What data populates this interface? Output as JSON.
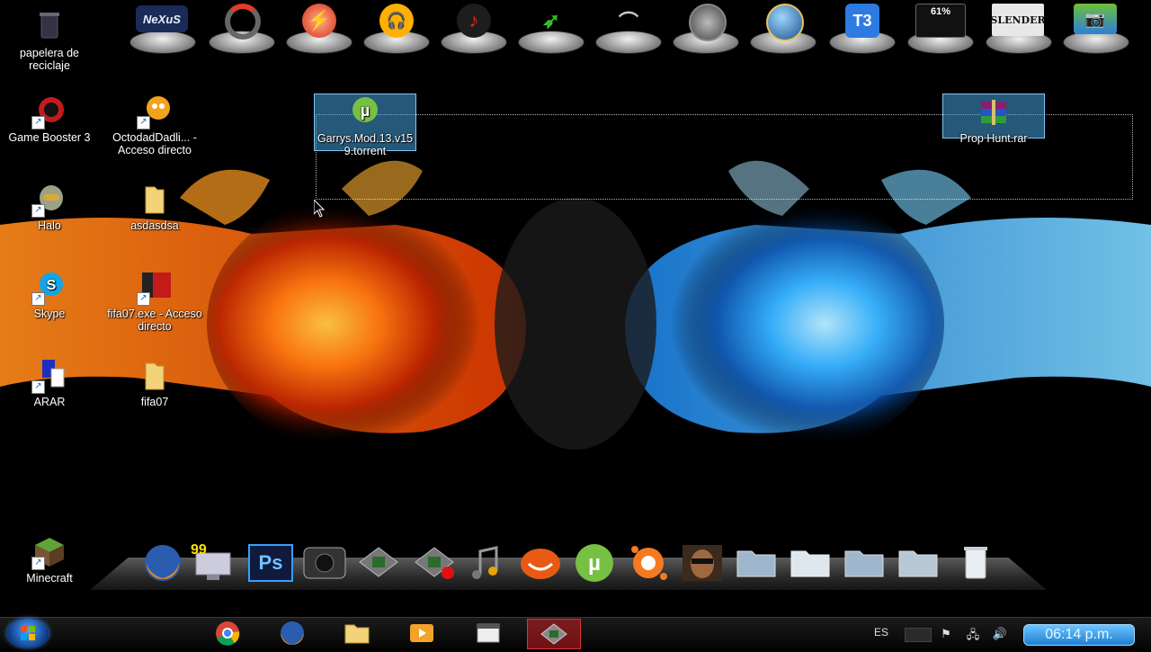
{
  "desktop": {
    "icons": [
      {
        "label": "papelera de reciclaje"
      },
      {
        "label": "Game Booster 3"
      },
      {
        "label": "OctodadDadli... - Acceso directo"
      },
      {
        "label": "Halo"
      },
      {
        "label": "asdasdsa"
      },
      {
        "label": "Skype"
      },
      {
        "label": "fifa07.exe - Acceso directo"
      },
      {
        "label": "ARAR"
      },
      {
        "label": "fifa07"
      },
      {
        "label": "Minecraft"
      },
      {
        "label": "Garrys.Mod.13.v159.torrent"
      },
      {
        "label": "Prop Hunt.rar"
      }
    ]
  },
  "top_dock": {
    "nexus_label": "NeXuS",
    "cpu_gadget_percent": "61%",
    "slender_label": "SLENDER",
    "t3_label": "T3"
  },
  "bottom_dock": {
    "badge_99": "99",
    "ps_label": "Ps"
  },
  "taskbar": {
    "language": "ES",
    "clock": "06:14 p.m."
  },
  "colors": {
    "accent": "#1d7fd0",
    "fire": "#ff6a00",
    "ice": "#2aa8ff"
  }
}
